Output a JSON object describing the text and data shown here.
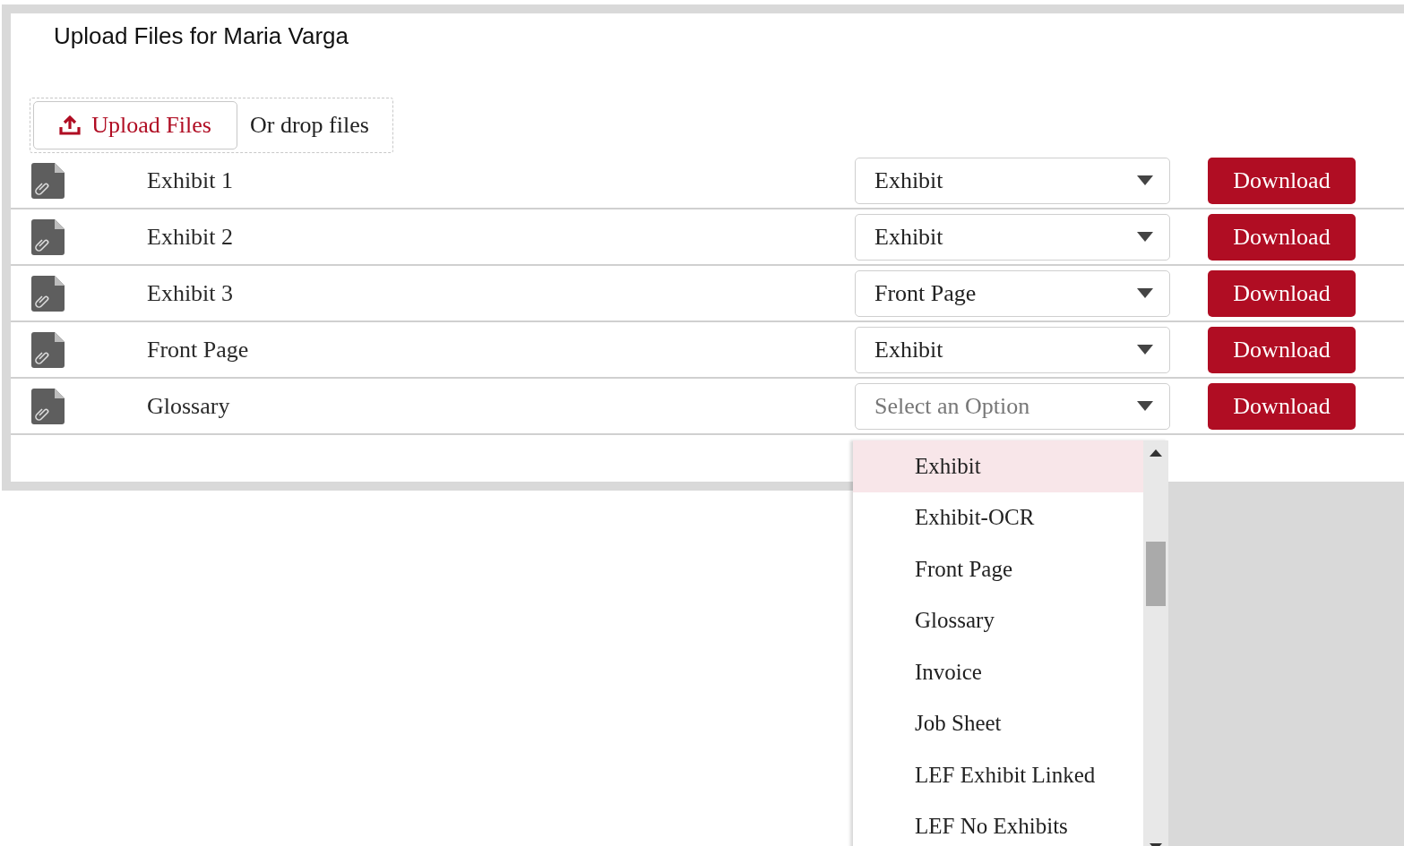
{
  "title": "Upload Files for Maria Varga",
  "upload": {
    "button_label": "Upload Files",
    "drop_hint": "Or drop files"
  },
  "files": [
    {
      "name": "Exhibit 1",
      "type": {
        "value": "Exhibit"
      },
      "download_label": "Download"
    },
    {
      "name": "Exhibit 2",
      "type": {
        "value": "Exhibit"
      },
      "download_label": "Download"
    },
    {
      "name": "Exhibit 3",
      "type": {
        "value": "Front Page"
      },
      "download_label": "Download"
    },
    {
      "name": "Front Page",
      "type": {
        "value": "Exhibit"
      },
      "download_label": "Download"
    },
    {
      "name": "Glossary",
      "type": {
        "placeholder": "Select an Option"
      },
      "download_label": "Download"
    }
  ],
  "dropdown": {
    "options": [
      {
        "label": "Exhibit",
        "selected": true
      },
      {
        "label": "Exhibit-OCR",
        "selected": false
      },
      {
        "label": "Front Page",
        "selected": false
      },
      {
        "label": "Glossary",
        "selected": false
      },
      {
        "label": "Invoice",
        "selected": false
      },
      {
        "label": "Job Sheet",
        "selected": false
      },
      {
        "label": "LEF Exhibit Linked",
        "selected": false
      },
      {
        "label": "LEF No Exhibits",
        "selected": false
      }
    ]
  }
}
